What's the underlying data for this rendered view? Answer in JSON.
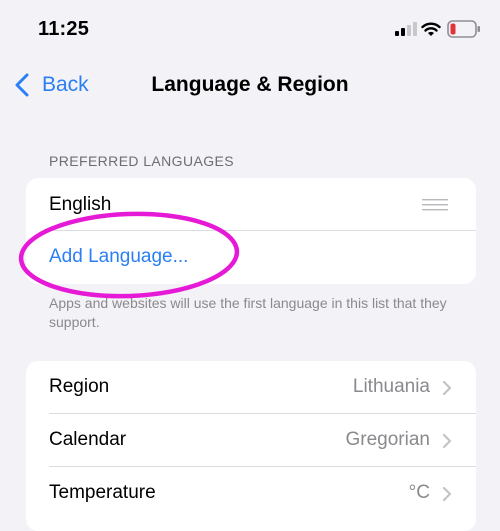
{
  "status_bar": {
    "time": "11:25",
    "battery_color": "#e0333a"
  },
  "nav": {
    "back_label": "Back",
    "title": "Language & Region"
  },
  "preferred_languages": {
    "header": "PREFERRED LANGUAGES",
    "languages": [
      "English"
    ],
    "add_label": "Add Language...",
    "footer": "Apps and websites will use the first language in this list that they support."
  },
  "settings": {
    "rows": [
      {
        "label": "Region",
        "value": "Lithuania"
      },
      {
        "label": "Calendar",
        "value": "Gregorian"
      },
      {
        "label": "Temperature",
        "value": "°C"
      }
    ]
  },
  "colors": {
    "accent": "#2b7ff4",
    "highlight": "#e61ad6",
    "background": "#f2f2f7"
  }
}
